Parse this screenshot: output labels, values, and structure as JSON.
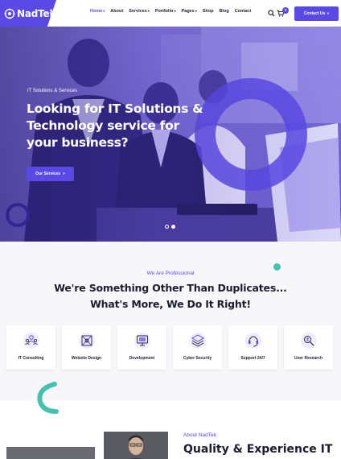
{
  "brand": {
    "name": "NadTek",
    "accent": "#5b49e6",
    "teal": "#45c1b0"
  },
  "nav": {
    "items": [
      {
        "label": "Home",
        "caret": true,
        "active": true
      },
      {
        "label": "About",
        "caret": false,
        "active": false
      },
      {
        "label": "Services",
        "caret": true,
        "active": false
      },
      {
        "label": "Portfolio",
        "caret": true,
        "active": false
      },
      {
        "label": "Pages",
        "caret": true,
        "active": false
      },
      {
        "label": "Shop",
        "caret": false,
        "active": false
      },
      {
        "label": "Blog",
        "caret": false,
        "active": false
      },
      {
        "label": "Contact",
        "caret": false,
        "active": false
      }
    ],
    "cart_count": "0",
    "contact_button": "Contact Us",
    "icons": [
      "search-icon",
      "cart-icon",
      "arrow-icon"
    ]
  },
  "hero": {
    "eyebrow": "IT Solutions & Services",
    "title": "Looking for IT Solutions & Technology service for your business?",
    "button": "Our Services",
    "slides_total": 2,
    "slide_active": 2
  },
  "services": {
    "eyebrow": "We Are Professional",
    "title_line1": "We're Something Other Than Duplicates...",
    "title_line2": "What's More, We Do It Right!",
    "items": [
      {
        "label": "IT Consulting",
        "icon": "team-icon"
      },
      {
        "label": "Website Design",
        "icon": "design-icon"
      },
      {
        "label": "Development",
        "icon": "monitor-icon"
      },
      {
        "label": "Cyber Security",
        "icon": "layers-icon"
      },
      {
        "label": "Support 24/7",
        "icon": "support-icon"
      },
      {
        "label": "User Research",
        "icon": "research-icon"
      }
    ]
  },
  "about": {
    "eyebrow": "About NadTek",
    "title": "Quality & Experience IT"
  }
}
